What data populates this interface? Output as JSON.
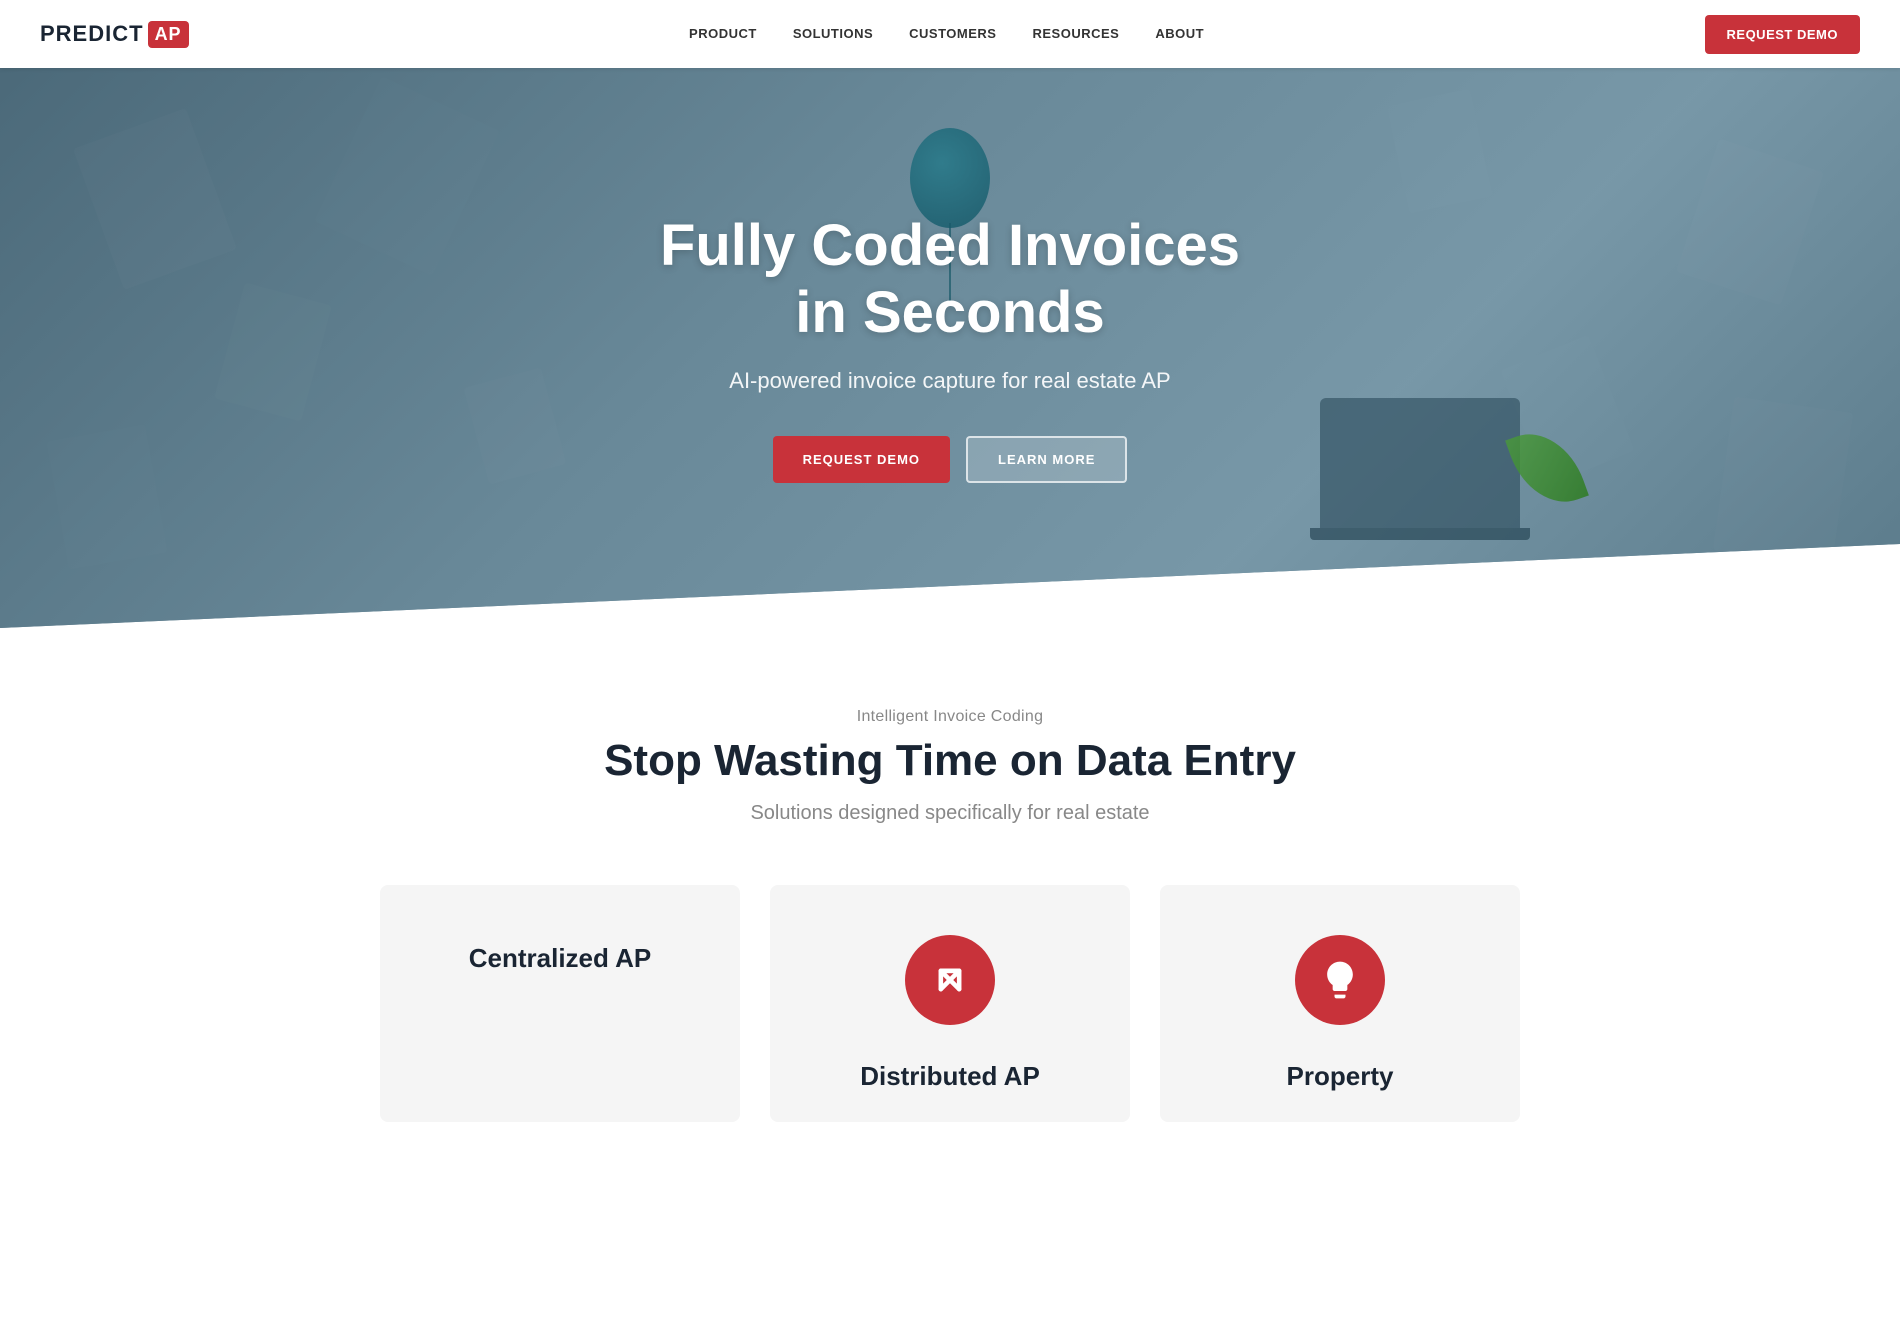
{
  "brand": {
    "name": "PREDICT",
    "logo_ap": "AP"
  },
  "nav": {
    "links": [
      {
        "id": "product",
        "label": "PRODUCT"
      },
      {
        "id": "solutions",
        "label": "SOLUTIONS"
      },
      {
        "id": "customers",
        "label": "CUSTOMERS"
      },
      {
        "id": "resources",
        "label": "RESOURCES"
      },
      {
        "id": "about",
        "label": "ABOUT"
      }
    ],
    "cta_label": "REQUEST DEMO"
  },
  "hero": {
    "title_line1": "Fully Coded Invoices",
    "title_line2": "in Seconds",
    "subtitle": "AI-powered invoice capture for real estate AP",
    "btn_primary": "REQUEST DEMO",
    "btn_secondary": "LEARN MORE"
  },
  "features": {
    "section_subtitle": "Intelligent Invoice Coding",
    "section_title": "Stop Wasting Time on Data Entry",
    "section_desc": "Solutions designed specifically for real estate",
    "cards": [
      {
        "id": "centralized",
        "icon": "centralize",
        "title": "Centralized AP"
      },
      {
        "id": "distributed",
        "icon": "distribute",
        "title": "Distributed AP"
      },
      {
        "id": "property",
        "icon": "lightbulb",
        "title": "Property"
      }
    ]
  },
  "colors": {
    "primary_red": "#c8323a",
    "dark_blue": "#1a2533",
    "hero_bg": "#5a7a8a"
  }
}
